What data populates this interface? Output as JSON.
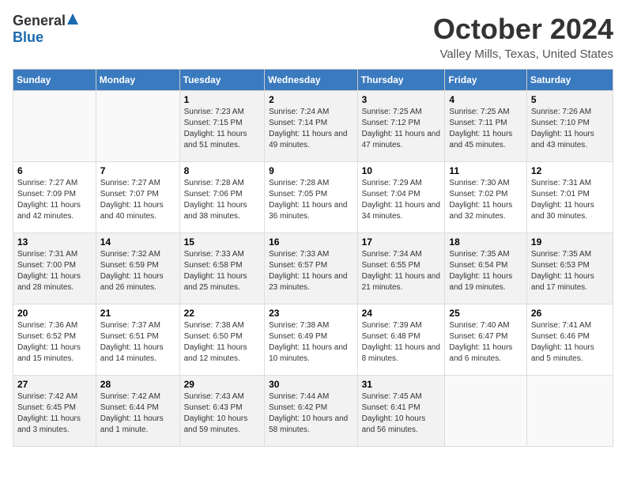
{
  "logo": {
    "general": "General",
    "blue": "Blue"
  },
  "title": "October 2024",
  "subtitle": "Valley Mills, Texas, United States",
  "days_of_week": [
    "Sunday",
    "Monday",
    "Tuesday",
    "Wednesday",
    "Thursday",
    "Friday",
    "Saturday"
  ],
  "weeks": [
    [
      {
        "day": "",
        "info": ""
      },
      {
        "day": "",
        "info": ""
      },
      {
        "day": "1",
        "info": "Sunrise: 7:23 AM\nSunset: 7:15 PM\nDaylight: 11 hours and 51 minutes."
      },
      {
        "day": "2",
        "info": "Sunrise: 7:24 AM\nSunset: 7:14 PM\nDaylight: 11 hours and 49 minutes."
      },
      {
        "day": "3",
        "info": "Sunrise: 7:25 AM\nSunset: 7:12 PM\nDaylight: 11 hours and 47 minutes."
      },
      {
        "day": "4",
        "info": "Sunrise: 7:25 AM\nSunset: 7:11 PM\nDaylight: 11 hours and 45 minutes."
      },
      {
        "day": "5",
        "info": "Sunrise: 7:26 AM\nSunset: 7:10 PM\nDaylight: 11 hours and 43 minutes."
      }
    ],
    [
      {
        "day": "6",
        "info": "Sunrise: 7:27 AM\nSunset: 7:09 PM\nDaylight: 11 hours and 42 minutes."
      },
      {
        "day": "7",
        "info": "Sunrise: 7:27 AM\nSunset: 7:07 PM\nDaylight: 11 hours and 40 minutes."
      },
      {
        "day": "8",
        "info": "Sunrise: 7:28 AM\nSunset: 7:06 PM\nDaylight: 11 hours and 38 minutes."
      },
      {
        "day": "9",
        "info": "Sunrise: 7:28 AM\nSunset: 7:05 PM\nDaylight: 11 hours and 36 minutes."
      },
      {
        "day": "10",
        "info": "Sunrise: 7:29 AM\nSunset: 7:04 PM\nDaylight: 11 hours and 34 minutes."
      },
      {
        "day": "11",
        "info": "Sunrise: 7:30 AM\nSunset: 7:02 PM\nDaylight: 11 hours and 32 minutes."
      },
      {
        "day": "12",
        "info": "Sunrise: 7:31 AM\nSunset: 7:01 PM\nDaylight: 11 hours and 30 minutes."
      }
    ],
    [
      {
        "day": "13",
        "info": "Sunrise: 7:31 AM\nSunset: 7:00 PM\nDaylight: 11 hours and 28 minutes."
      },
      {
        "day": "14",
        "info": "Sunrise: 7:32 AM\nSunset: 6:59 PM\nDaylight: 11 hours and 26 minutes."
      },
      {
        "day": "15",
        "info": "Sunrise: 7:33 AM\nSunset: 6:58 PM\nDaylight: 11 hours and 25 minutes."
      },
      {
        "day": "16",
        "info": "Sunrise: 7:33 AM\nSunset: 6:57 PM\nDaylight: 11 hours and 23 minutes."
      },
      {
        "day": "17",
        "info": "Sunrise: 7:34 AM\nSunset: 6:55 PM\nDaylight: 11 hours and 21 minutes."
      },
      {
        "day": "18",
        "info": "Sunrise: 7:35 AM\nSunset: 6:54 PM\nDaylight: 11 hours and 19 minutes."
      },
      {
        "day": "19",
        "info": "Sunrise: 7:35 AM\nSunset: 6:53 PM\nDaylight: 11 hours and 17 minutes."
      }
    ],
    [
      {
        "day": "20",
        "info": "Sunrise: 7:36 AM\nSunset: 6:52 PM\nDaylight: 11 hours and 15 minutes."
      },
      {
        "day": "21",
        "info": "Sunrise: 7:37 AM\nSunset: 6:51 PM\nDaylight: 11 hours and 14 minutes."
      },
      {
        "day": "22",
        "info": "Sunrise: 7:38 AM\nSunset: 6:50 PM\nDaylight: 11 hours and 12 minutes."
      },
      {
        "day": "23",
        "info": "Sunrise: 7:38 AM\nSunset: 6:49 PM\nDaylight: 11 hours and 10 minutes."
      },
      {
        "day": "24",
        "info": "Sunrise: 7:39 AM\nSunset: 6:48 PM\nDaylight: 11 hours and 8 minutes."
      },
      {
        "day": "25",
        "info": "Sunrise: 7:40 AM\nSunset: 6:47 PM\nDaylight: 11 hours and 6 minutes."
      },
      {
        "day": "26",
        "info": "Sunrise: 7:41 AM\nSunset: 6:46 PM\nDaylight: 11 hours and 5 minutes."
      }
    ],
    [
      {
        "day": "27",
        "info": "Sunrise: 7:42 AM\nSunset: 6:45 PM\nDaylight: 11 hours and 3 minutes."
      },
      {
        "day": "28",
        "info": "Sunrise: 7:42 AM\nSunset: 6:44 PM\nDaylight: 11 hours and 1 minute."
      },
      {
        "day": "29",
        "info": "Sunrise: 7:43 AM\nSunset: 6:43 PM\nDaylight: 10 hours and 59 minutes."
      },
      {
        "day": "30",
        "info": "Sunrise: 7:44 AM\nSunset: 6:42 PM\nDaylight: 10 hours and 58 minutes."
      },
      {
        "day": "31",
        "info": "Sunrise: 7:45 AM\nSunset: 6:41 PM\nDaylight: 10 hours and 56 minutes."
      },
      {
        "day": "",
        "info": ""
      },
      {
        "day": "",
        "info": ""
      }
    ]
  ]
}
